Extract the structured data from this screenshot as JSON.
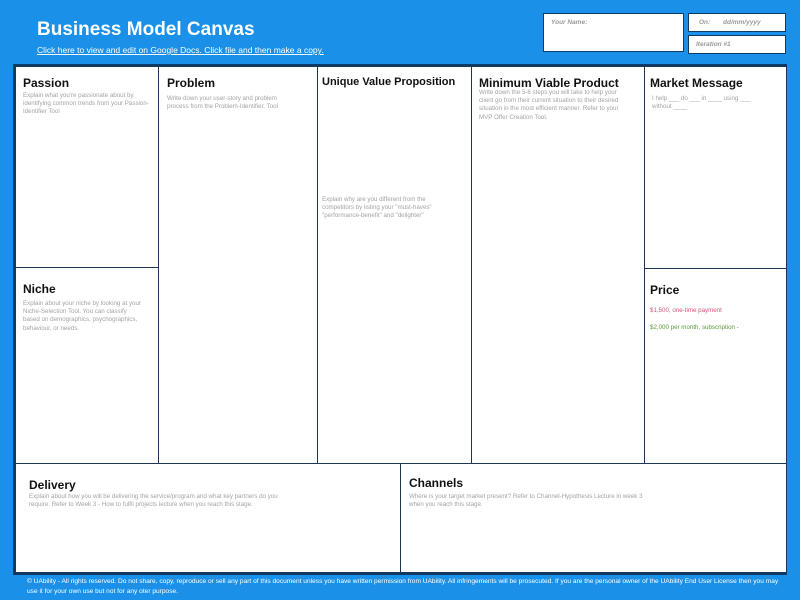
{
  "header": {
    "title": "Business Model Canvas",
    "link": "Click here to view and edit on Google Docs. Click file and then make a copy."
  },
  "fields": {
    "name_label": "Your Name:",
    "on_label": "On:",
    "date_placeholder": "dd/mm/yyyy",
    "iteration": "Iteration #1"
  },
  "sections": {
    "passion": {
      "title": "Passion",
      "text": "Explain what you're passionate about by identifying common trends from your Passion-Identifier Tool"
    },
    "niche": {
      "title": "Niche",
      "text": "Explain about your niche by looking at your Niche-Selection Tool. You can classify based on demographics, psychographics, behaviour, or needs."
    },
    "problem": {
      "title": "Problem",
      "text": "Write down your user-story and problem process from the Problem-Identifier. Tool"
    },
    "uvp": {
      "title": "Unique Value Proposition",
      "text": "Explain why are you different from the competitors by listing your \"must-haves\" \"performance-benefit\" and \"delighter\""
    },
    "mvp": {
      "title": "Minimum Viable Product",
      "text": "Write down the 5-6 steps you will take to help your client go from their current situation to their desired situation in the most efficient manner. Refer to your MVP Offer Creation Tool."
    },
    "market_message": {
      "title": "Market Message",
      "text": "I help ___ do ___ in ____ using ___ without ____"
    },
    "price": {
      "title": "Price",
      "line1": "$1,500, one-time payment",
      "line2": "$2,000 per month, subscription -"
    },
    "delivery": {
      "title": "Delivery",
      "text": "Explain about how you will be delivering the service/program and what key partners do you require. Refer to Week 3 - How to fulfil projects lecture when you reach this stage."
    },
    "channels": {
      "title": "Channels",
      "text": "Where is your target market present? Refer to Channel-Hypothesis Lecture in week 3 when you reach this stage."
    }
  },
  "footer": {
    "text": "© UAbility - All rights reserved.  Do not share, copy, reproduce or sell any part of this document unless you have written permission from UAbility.  All infringements will be prosecuted.  If you are the personal owner of the UAbility End User License then you may use it for your own use but not for any oter purpose."
  },
  "colors": {
    "background": "#1a90e8",
    "border": "#0b3b66",
    "price_line1": "#d4567a",
    "price_line2": "#5a9a3a"
  }
}
